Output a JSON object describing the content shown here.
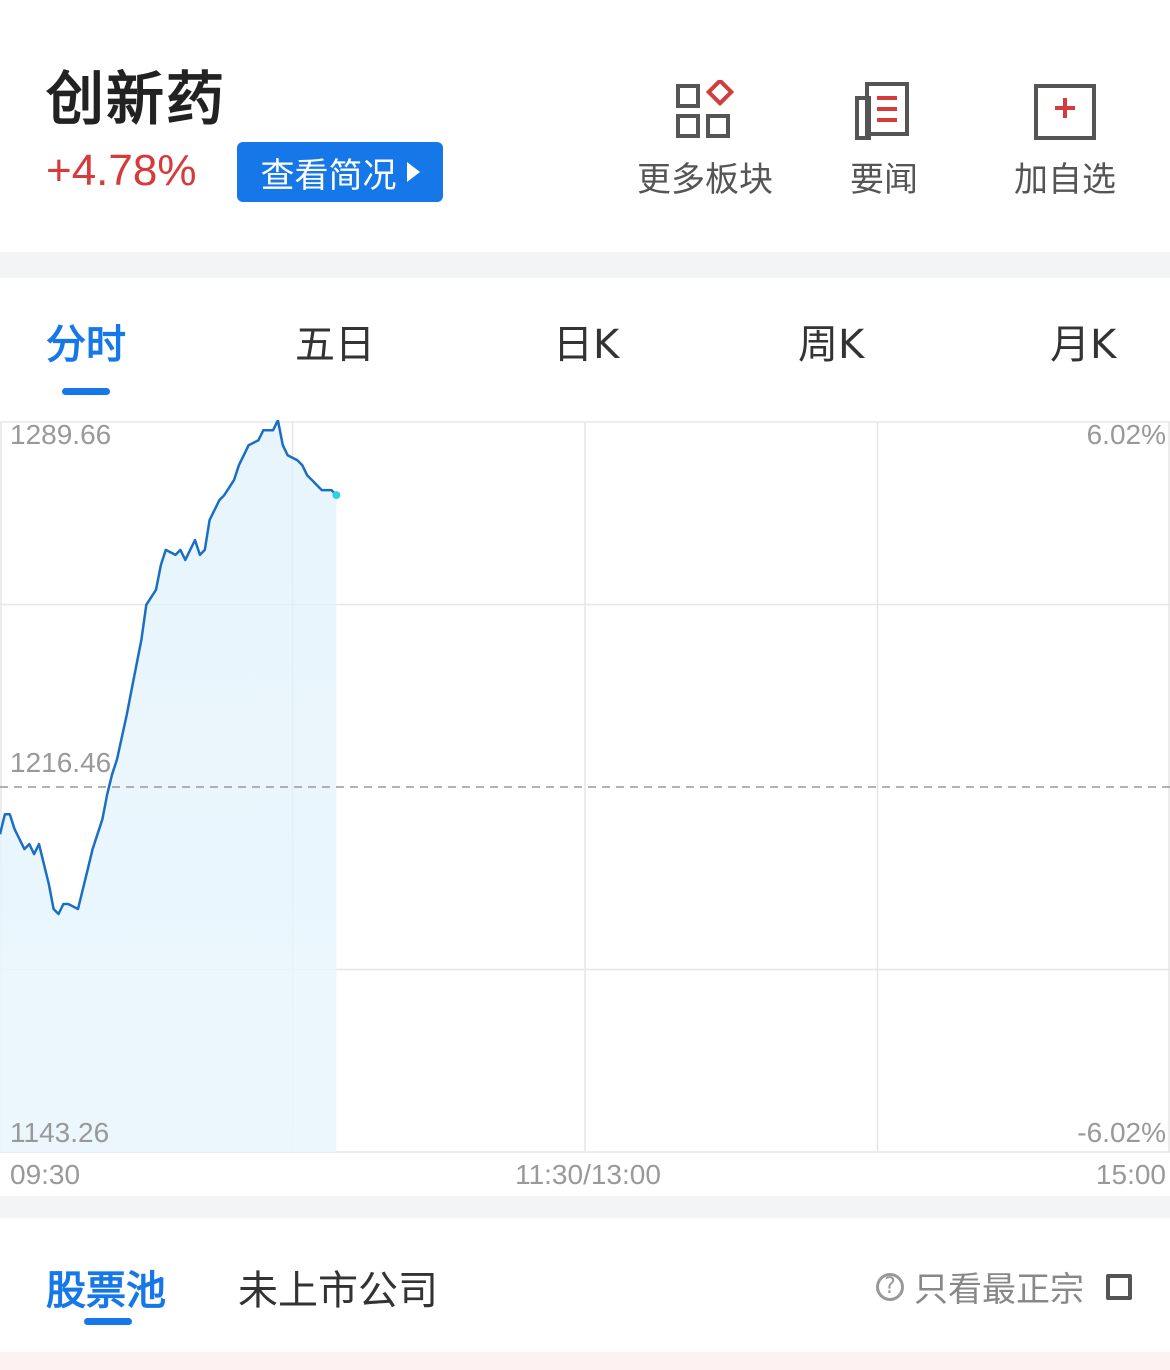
{
  "header": {
    "title": "创新药",
    "change": "+4.78%",
    "overview_label": "查看简况",
    "actions": [
      {
        "label": "更多板块",
        "icon": "sector-grid-icon"
      },
      {
        "label": "要闻",
        "icon": "news-icon"
      },
      {
        "label": "加自选",
        "icon": "add-watchlist-icon"
      }
    ]
  },
  "tabs": [
    "分时",
    "五日",
    "日K",
    "周K",
    "月K"
  ],
  "active_tab": "分时",
  "colors": {
    "accent": "#1677e8",
    "up": "#d63a3a",
    "line": "#1a6fc4"
  },
  "chart_data": {
    "type": "area",
    "y_labels": {
      "top": "1289.66",
      "mid": "1216.46",
      "bottom": "1143.26"
    },
    "pct_labels": {
      "top": "6.02%",
      "bottom": "-6.02%"
    },
    "x_labels": [
      "09:30",
      "11:30/13:00",
      "15:00"
    ],
    "ylim": [
      1143.26,
      1289.66
    ],
    "prev_close": 1216.46,
    "x_unit": "minutes since 09:30 (240 trading minutes)",
    "series": [
      {
        "x": [
          0,
          1,
          2,
          3,
          5,
          6,
          7,
          8,
          9,
          10,
          11,
          12,
          13,
          14,
          16,
          17,
          18,
          19,
          21,
          22,
          23,
          24,
          26,
          27,
          29,
          30,
          32,
          33,
          34,
          36,
          37,
          38,
          40,
          41,
          42,
          43,
          44,
          45,
          46,
          48,
          49,
          50,
          51,
          53,
          54,
          56,
          57,
          58,
          59,
          61,
          62,
          63,
          64,
          65,
          66,
          68,
          69
        ],
        "values": [
          1207,
          1211,
          1211,
          1208,
          1204,
          1205,
          1203,
          1205,
          1201,
          1197,
          1192,
          1191,
          1193,
          1193,
          1192,
          1196,
          1200,
          1204,
          1210,
          1215,
          1219,
          1222,
          1231,
          1236,
          1246,
          1253,
          1256,
          1261,
          1264,
          1263,
          1264,
          1262,
          1266,
          1263,
          1264,
          1270,
          1272,
          1274,
          1275,
          1278,
          1281,
          1283,
          1285,
          1286,
          1288,
          1288,
          1290,
          1285,
          1283,
          1282,
          1281,
          1279,
          1278,
          1277,
          1276,
          1276,
          1275
        ]
      }
    ]
  },
  "bottom": {
    "tabs": [
      "股票池",
      "未上市公司"
    ],
    "filter_label": "只看最正宗"
  }
}
